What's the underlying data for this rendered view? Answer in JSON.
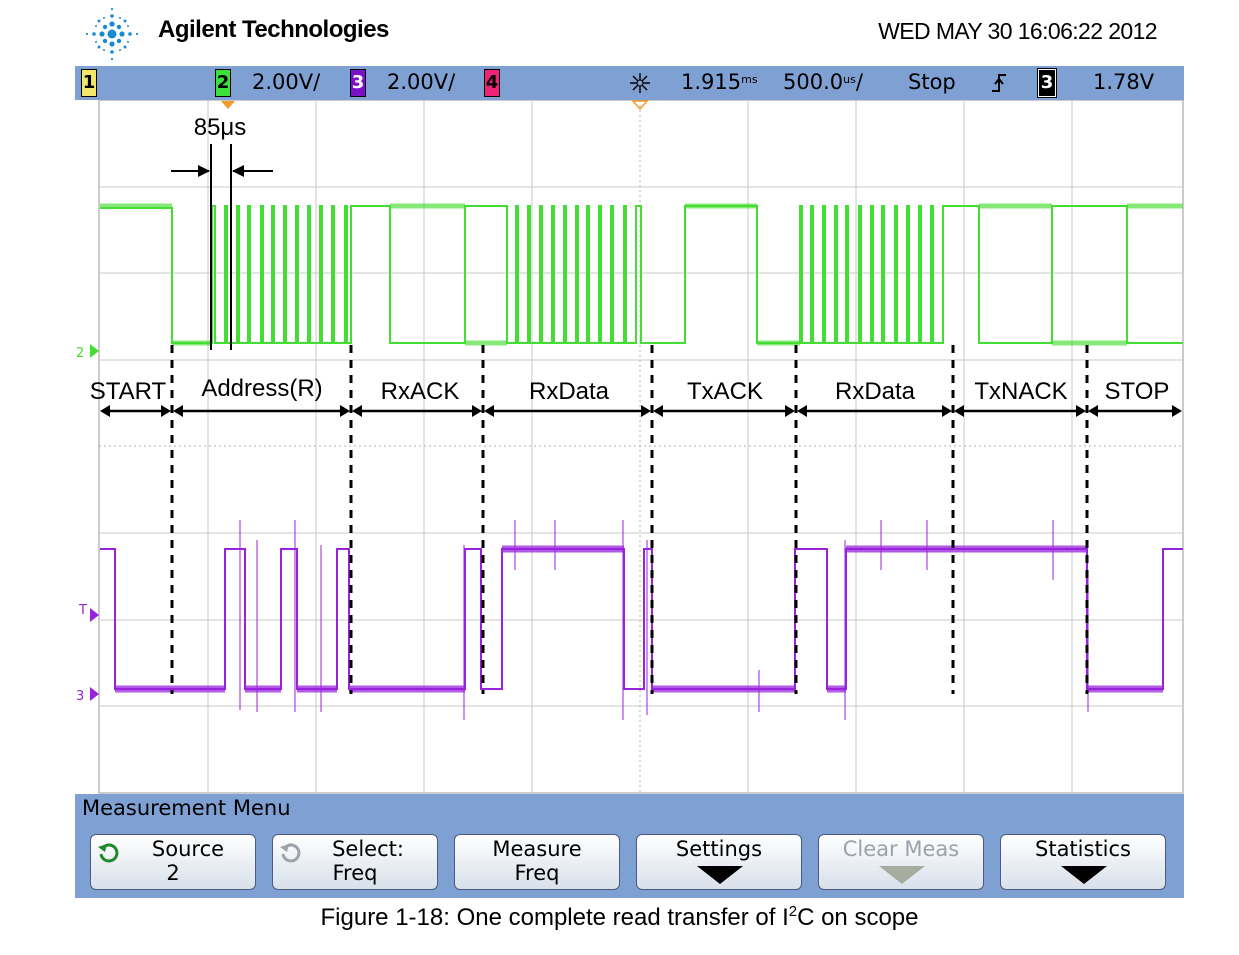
{
  "header": {
    "brand": "Agilent Technologies",
    "datetime": "WED MAY 30 16:06:22 2012"
  },
  "statusbar": {
    "ch1": "1",
    "ch2": "2",
    "ch2_scale": "2.00V/",
    "ch3": "3",
    "ch3_scale": "2.00V/",
    "ch4": "4",
    "time_offset": "1.915",
    "time_offset_unit": "ms",
    "timebase": "500.0",
    "timebase_unit": "us",
    "timebase_suffix": "/",
    "run_state": "Stop",
    "trigger_slope": "rising-edge-icon",
    "trigger_channel": "3",
    "trigger_level": "1.78V"
  },
  "scope": {
    "ch2_marker": "2",
    "trig_marker": "T",
    "ch3_marker": "3",
    "annotation_width": "85μs",
    "phases": [
      "START",
      "Address(R)",
      "RxACK",
      "RxData",
      "TxACK",
      "RxData",
      "TxNACK",
      "STOP"
    ],
    "colors": {
      "ch2_trace": "#44dd33",
      "ch3_trace": "#9922dd",
      "grid": "#c0c0c0",
      "marker_orange": "#f39a2a"
    }
  },
  "menu": {
    "title": "Measurement Menu",
    "softkeys": [
      {
        "line1": "Source",
        "line2": "2",
        "icon": "rotate-knob-icon"
      },
      {
        "line1": "Select:",
        "line2": "Freq",
        "icon": "rotate-knob-icon"
      },
      {
        "line1": "Measure",
        "line2": "Freq"
      },
      {
        "line1": "Settings",
        "line2": "",
        "icon": "down-arrow-icon"
      },
      {
        "line1": "Clear Meas",
        "line2": "",
        "icon": "down-arrow-icon"
      },
      {
        "line1": "Statistics",
        "line2": "",
        "icon": "down-arrow-icon"
      }
    ]
  },
  "caption": {
    "prefix": "Figure 1-18: One complete read transfer of I",
    "sup": "2",
    "suffix": "C on scope"
  }
}
